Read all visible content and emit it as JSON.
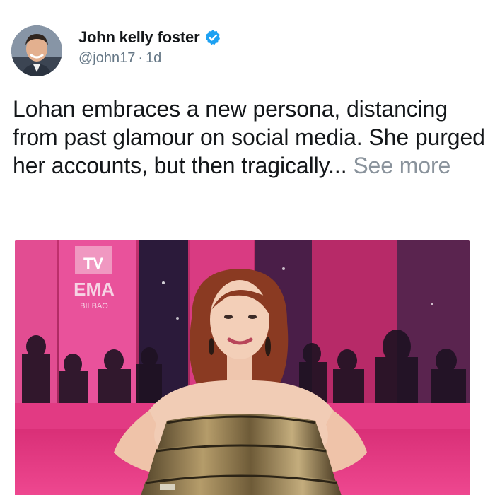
{
  "author": {
    "display_name": "John kelly foster",
    "handle": "@john17",
    "separator": "·",
    "age": "1d",
    "verified": true,
    "avatar_icon": "user-avatar-photo"
  },
  "tweet": {
    "text": "Lohan embraces a new persona, distancing from past glamour on social media. She purged her accounts, but then tragically...",
    "see_more_label": "See more"
  },
  "media": {
    "backdrop_brand": "EMA",
    "backdrop_city": "BILBAO",
    "backdrop_logo": "TV"
  },
  "colors": {
    "verified_blue": "#1da1f2",
    "name_text": "#14171a",
    "meta_text": "#657786",
    "see_more": "#8a939c",
    "carpet_pink": "#e0357f"
  }
}
